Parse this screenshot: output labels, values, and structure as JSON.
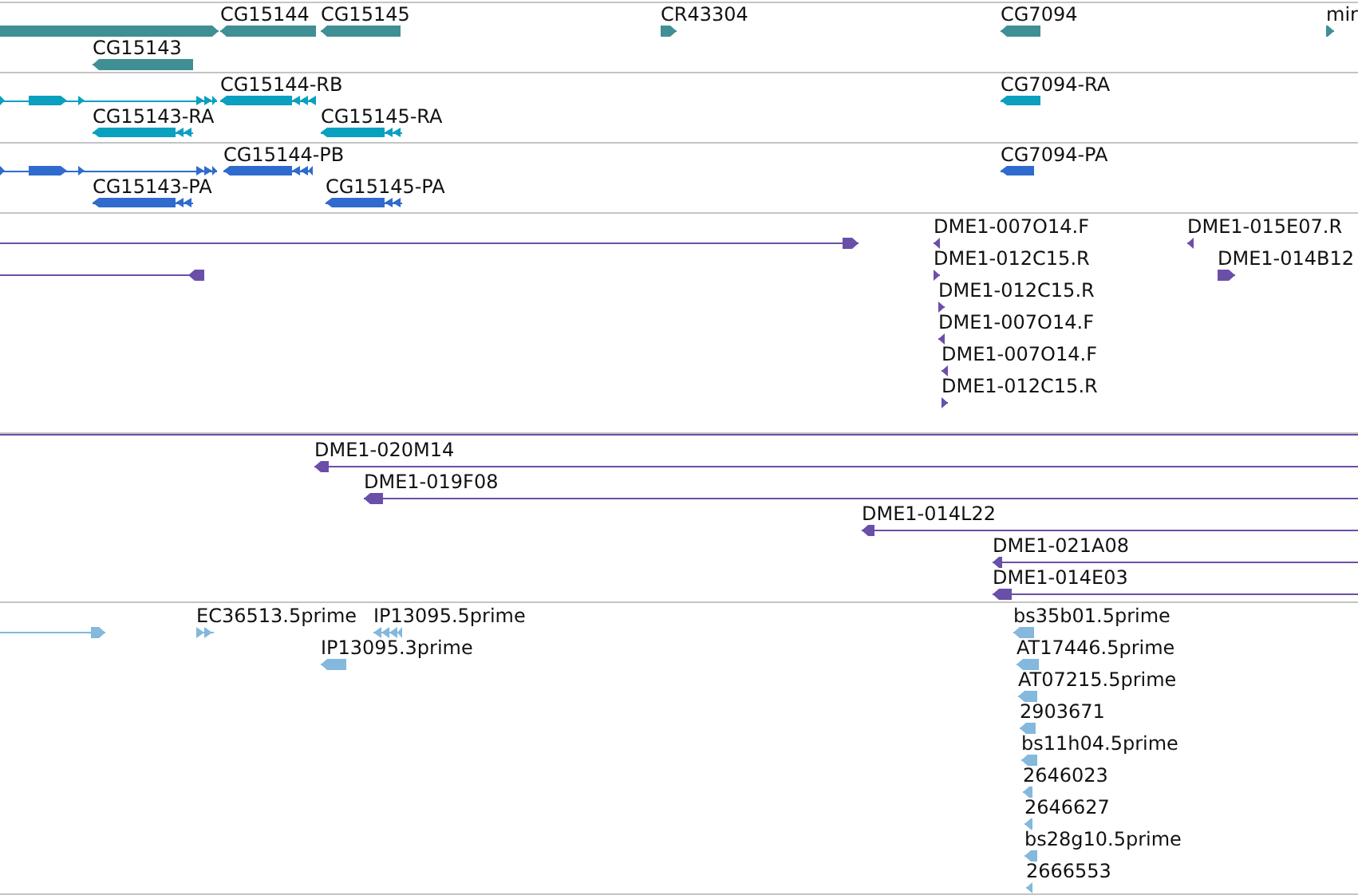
{
  "tracks": [
    {
      "kind": "gene",
      "color": "#3f8f94",
      "features": [
        {
          "reverse": false
        },
        {
          "label": "CG15144",
          "reverse": true
        },
        {
          "label": "CG15145",
          "reverse": true
        },
        {
          "label": "CR43304",
          "reverse": false
        },
        {
          "label": "CG7094",
          "reverse": true
        },
        {
          "label": "mir",
          "reverse": false
        },
        {
          "label": "CG15143",
          "reverse": true
        }
      ]
    },
    {
      "kind": "transcript",
      "color": "#0aa0bf",
      "features": [
        {
          "reverse": false
        },
        {
          "label": "CG15144-RB",
          "reverse": true
        },
        {
          "label": "CG7094-RA",
          "reverse": true
        },
        {
          "label": "CG15143-RA",
          "reverse": true
        },
        {
          "label": "CG15145-RA",
          "reverse": true
        }
      ]
    },
    {
      "kind": "transcript",
      "color": "#2f6bcc",
      "features": [
        {
          "reverse": false
        },
        {
          "label": "CG15144-PB",
          "reverse": true
        },
        {
          "label": "CG7094-PA",
          "reverse": true
        },
        {
          "label": "CG15143-PA",
          "reverse": true
        },
        {
          "label": "CG15145-PA",
          "reverse": true
        }
      ]
    },
    {
      "kind": "clone",
      "color": "#6a4fa8",
      "features": [
        {
          "reverse": false
        },
        {
          "reverse": true
        },
        {
          "label": "DME1-007O14.F",
          "reverse": true
        },
        {
          "label": "DME1-012C15.R",
          "reverse": false
        },
        {
          "label": "DME1-012C15.R",
          "reverse": false
        },
        {
          "label": "DME1-007O14.F",
          "reverse": true
        },
        {
          "label": "DME1-007O14.F",
          "reverse": true
        },
        {
          "label": "DME1-012C15.R",
          "reverse": false
        },
        {
          "label": "DME1-015E07.R",
          "reverse": true
        },
        {
          "label": "DME1-014B12",
          "reverse": false
        }
      ]
    },
    {
      "kind": "clone",
      "color": "#6a4fa8",
      "features": [
        {
          "kind": "span"
        },
        {
          "kind": "arrow",
          "label": "DME1-020M14",
          "reverse": true
        },
        {
          "kind": "arrow",
          "label": "DME1-019F08",
          "reverse": true
        },
        {
          "kind": "arrow",
          "label": "DME1-014L22",
          "reverse": true
        },
        {
          "kind": "arrow",
          "label": "DME1-021A08",
          "reverse": true
        },
        {
          "kind": "arrow",
          "label": "DME1-014E03",
          "reverse": true
        }
      ]
    },
    {
      "kind": "est",
      "color": "#84b8dc",
      "features": [
        {
          "reverse": false
        },
        {
          "label": "EC36513.5prime",
          "reverse": false
        },
        {
          "label": "IP13095.5prime",
          "reverse": true
        },
        {
          "label": "IP13095.3prime",
          "reverse": true
        },
        {
          "label": "bs35b01.5prime",
          "reverse": true
        },
        {
          "label": "AT17446.5prime",
          "reverse": true
        },
        {
          "label": "AT07215.5prime",
          "reverse": true
        },
        {
          "label": "2903671",
          "reverse": true
        },
        {
          "label": "bs11h04.5prime",
          "reverse": true
        },
        {
          "label": "2646023",
          "reverse": true
        },
        {
          "label": "2646627",
          "reverse": true
        },
        {
          "label": "bs28g10.5prime",
          "reverse": true
        },
        {
          "label": "2666553",
          "reverse": true
        }
      ]
    }
  ]
}
